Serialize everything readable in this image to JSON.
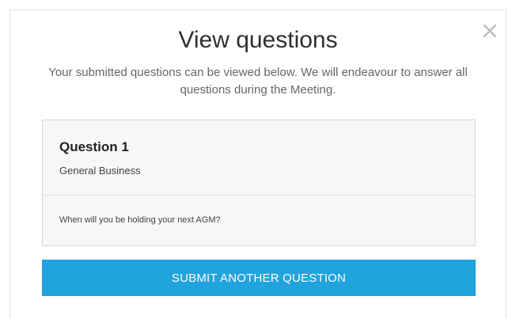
{
  "modal": {
    "title": "View questions",
    "subtitle": "Your submitted questions can be viewed below. We will endeavour to answer all questions during the Meeting.",
    "close_icon": "close-icon"
  },
  "questions": [
    {
      "title": "Question 1",
      "category": "General Business",
      "text": "When will you be holding your next AGM?"
    }
  ],
  "actions": {
    "submit_label": "SUBMIT ANOTHER QUESTION"
  },
  "colors": {
    "accent": "#21a3de",
    "card_background": "#f7f7f7",
    "border": "#d6d6d6"
  }
}
